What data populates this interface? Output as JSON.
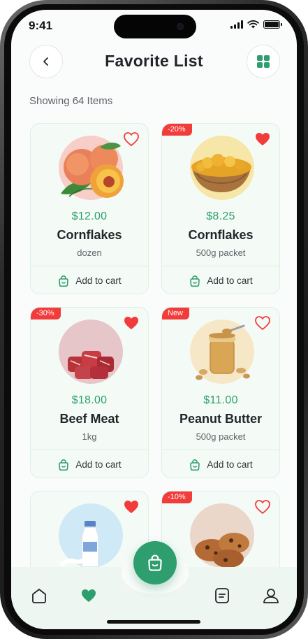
{
  "status_bar": {
    "time": "9:41"
  },
  "header": {
    "title": "Favorite List",
    "back_icon": "chevron-left-icon",
    "grid_icon": "grid-view-icon"
  },
  "summary": {
    "showing": "Showing 64 Items"
  },
  "colors": {
    "accent": "#2f9e6e",
    "price": "#2e9f6b",
    "badge": "#f23b3b",
    "heart": "#f23b3b"
  },
  "products": [
    {
      "badge": "",
      "favorited": false,
      "price": "$12.00",
      "name": "Cornflakes",
      "unit": "dozen",
      "cart_label": "Add to cart",
      "image": "peaches"
    },
    {
      "badge": "-20%",
      "favorited": true,
      "price": "$8.25",
      "name": "Cornflakes",
      "unit": "500g packet",
      "cart_label": "Add to cart",
      "image": "cornflakes-bowl"
    },
    {
      "badge": "-30%",
      "favorited": true,
      "price": "$18.00",
      "name": "Beef Meat",
      "unit": "1kg",
      "cart_label": "Add to cart",
      "image": "beef-cubes"
    },
    {
      "badge": "New",
      "favorited": false,
      "price": "$11.00",
      "name": "Peanut Butter",
      "unit": "500g packet",
      "cart_label": "Add to cart",
      "image": "peanut-butter-jar"
    },
    {
      "badge": "",
      "favorited": true,
      "image": "milk-bottle"
    },
    {
      "badge": "-10%",
      "favorited": false,
      "image": "cookies"
    }
  ],
  "nav": {
    "items": [
      "home-icon",
      "heart-icon",
      "cart-icon",
      "orders-icon",
      "profile-icon"
    ]
  }
}
